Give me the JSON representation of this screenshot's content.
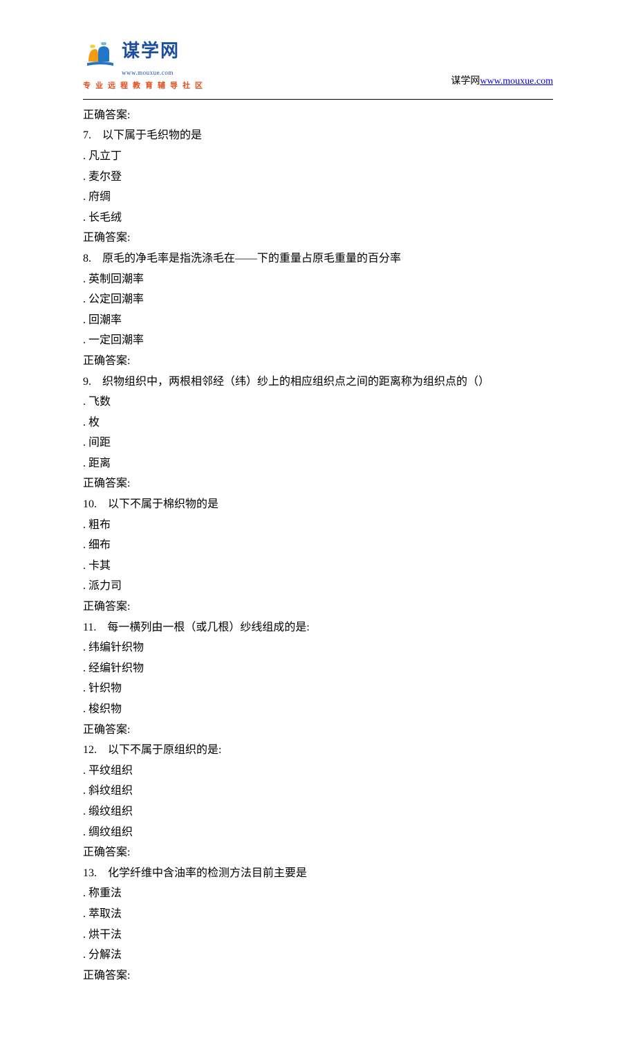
{
  "header": {
    "logo_cn": "谋学网",
    "logo_url": "www.mouxue.com",
    "tagline": "专业远程教育辅导社区",
    "right_text": "谋学网",
    "right_link": "www.mouxue.com"
  },
  "lines": [
    "正确答案:",
    "7.　以下属于毛织物的是",
    ". 凡立丁",
    ". 麦尔登",
    ". 府绸",
    ". 长毛绒",
    "正确答案:",
    "8.　原毛的净毛率是指洗涤毛在——下的重量占原毛重量的百分率",
    ". 英制回潮率",
    ". 公定回潮率",
    ". 回潮率",
    ". 一定回潮率",
    "正确答案:",
    "9.　织物组织中，两根相邻经（纬）纱上的相应组织点之间的距离称为组织点的（）",
    ". 飞数",
    ". 枚",
    ". 间距",
    ". 距离",
    "正确答案:",
    "10.　以下不属于棉织物的是",
    ". 粗布",
    ". 细布",
    ". 卡其",
    ". 派力司",
    "正确答案:",
    "11.　每一横列由一根（或几根）纱线组成的是:",
    ". 纬编针织物",
    ". 经编针织物",
    ". 针织物",
    ". 梭织物",
    "正确答案:",
    "12.　以下不属于原组织的是:",
    ". 平纹组织",
    ". 斜纹组织",
    ". 缎纹组织",
    ". 绸纹组织",
    "正确答案:",
    "13.　化学纤维中含油率的检测方法目前主要是",
    ". 称重法",
    ". 萃取法",
    ". 烘干法",
    ". 分解法",
    "正确答案:"
  ]
}
